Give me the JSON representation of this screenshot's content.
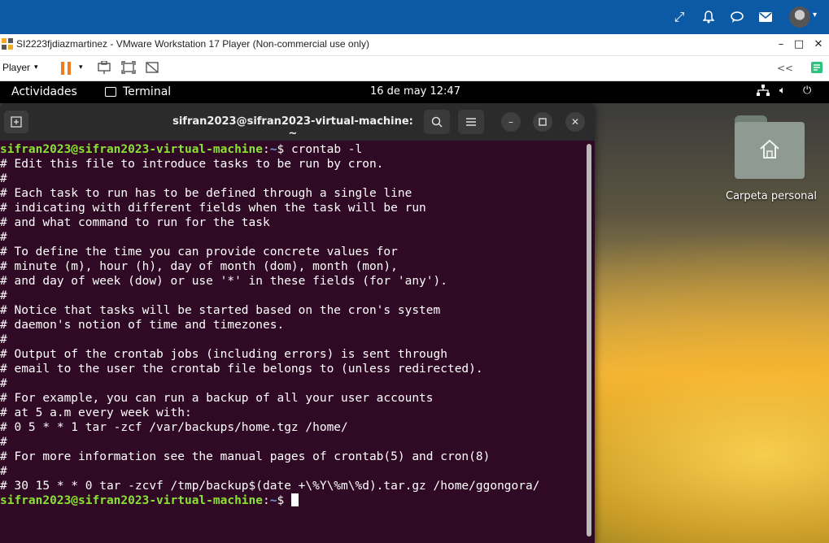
{
  "host_topbar": {
    "icons": [
      "expand-icon",
      "bell-icon",
      "chat-icon",
      "mail-icon"
    ],
    "avatar": "avatar",
    "bg_color": "#0c5aa6"
  },
  "vm_window": {
    "title": "SI2223fjdiazmartinez - VMware Workstation 17 Player (Non-commercial use only)",
    "minimize": "–",
    "maximize": "□",
    "close": "✕"
  },
  "vm_toolbar": {
    "player_label": "Player",
    "caret": "▾",
    "back_label": "<<"
  },
  "gnome_bar": {
    "activities": "Actividades",
    "app_name": "Terminal",
    "clock": "16 de may  12:47"
  },
  "desktop": {
    "folder_label": "Carpeta personal"
  },
  "terminal": {
    "title": "sifran2023@sifran2023-virtual-machine: ~",
    "prompt_user": "sifran2023@sifran2023-virtual-machine",
    "prompt_path": "~",
    "first_command": "crontab -l",
    "lines": [
      "# Edit this file to introduce tasks to be run by cron.",
      "#",
      "# Each task to run has to be defined through a single line",
      "# indicating with different fields when the task will be run",
      "# and what command to run for the task",
      "#",
      "# To define the time you can provide concrete values for",
      "# minute (m), hour (h), day of month (dom), month (mon),",
      "# and day of week (dow) or use '*' in these fields (for 'any').",
      "#",
      "# Notice that tasks will be started based on the cron's system",
      "# daemon's notion of time and timezones.",
      "#",
      "# Output of the crontab jobs (including errors) is sent through",
      "# email to the user the crontab file belongs to (unless redirected).",
      "#",
      "# For example, you can run a backup of all your user accounts",
      "# at 5 a.m every week with:",
      "# 0 5 * * 1 tar -zcf /var/backups/home.tgz /home/",
      "#",
      "# For more information see the manual pages of crontab(5) and cron(8)",
      "#",
      "# 30 15 * * 0 tar -zcvf /tmp/backup$(date +\\%Y\\%m\\%d).tar.gz /home/ggongora/"
    ]
  }
}
